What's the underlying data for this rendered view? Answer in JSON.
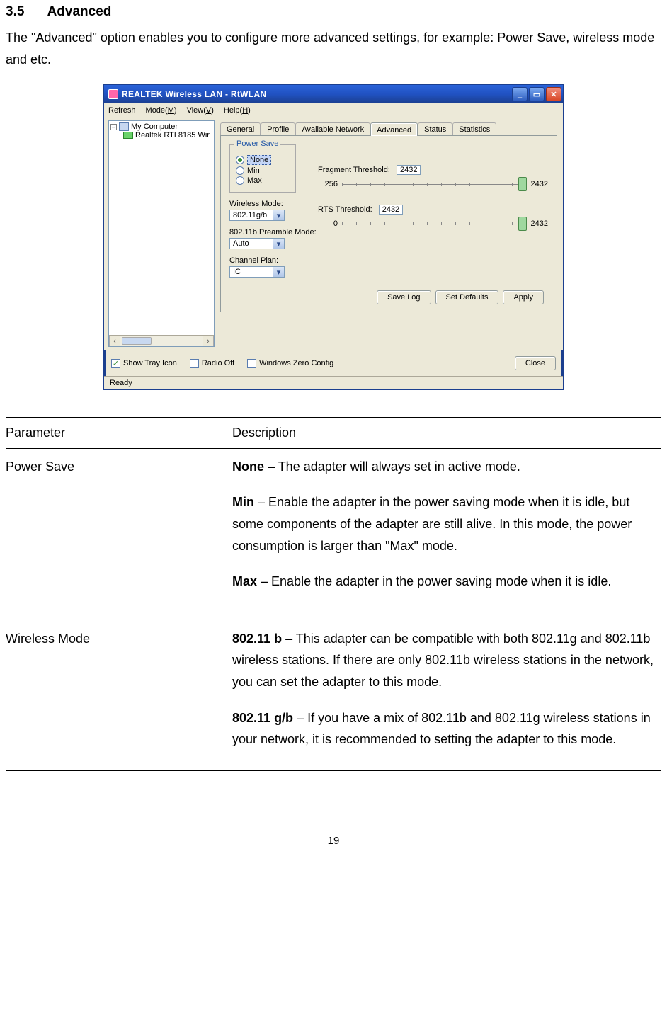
{
  "heading_num": "3.5",
  "heading_title": "Advanced",
  "intro": "The \"Advanced\" option enables you to configure more advanced settings, for example: Power Save, wireless mode and etc.",
  "window": {
    "title": "REALTEK Wireless LAN - RtWLAN",
    "menus": {
      "refresh": "Refresh",
      "mode": "Mode(M)",
      "view": "View(V)",
      "help": "Help(H)"
    },
    "tree": {
      "root": "My Computer",
      "child": "Realtek RTL8185 Wir",
      "expander": "–"
    },
    "tabs": {
      "general": "General",
      "profile": "Profile",
      "avail": "Available Network",
      "advanced": "Advanced",
      "status": "Status",
      "stats": "Statistics"
    },
    "power_save": {
      "legend": "Power Save",
      "none": "None",
      "min": "Min",
      "max": "Max"
    },
    "wireless_mode_label": "Wireless Mode:",
    "wireless_mode_value": "802.11g/b",
    "preamble_label": "802.11b Preamble Mode:",
    "preamble_value": "Auto",
    "channel_plan_label": "Channel Plan:",
    "channel_plan_value": "IC",
    "fragment": {
      "label": "Fragment Threshold:",
      "value": "2432",
      "min": "256",
      "max": "2432"
    },
    "rts": {
      "label": "RTS Threshold:",
      "value": "2432",
      "min": "0",
      "max": "2432"
    },
    "buttons": {
      "save_log": "Save Log",
      "set_defaults": "Set Defaults",
      "apply": "Apply",
      "close": "Close"
    },
    "checks": {
      "tray": "Show Tray Icon",
      "radio": "Radio Off",
      "wzc": "Windows Zero Config"
    },
    "status": "Ready"
  },
  "table": {
    "header_param": "Parameter",
    "header_desc": "Description",
    "power_save": {
      "param": "Power Save",
      "none_b": "None",
      "none_t": " – The adapter will always set in active mode.",
      "min_b": "Min",
      "min_t": " – Enable the adapter in the power saving mode when it is idle, but some components of the adapter are still alive. In this mode, the power consumption is larger than \"Max\" mode.",
      "max_b": "Max",
      "max_t": " – Enable the adapter in the power saving mode when it is idle."
    },
    "wireless_mode": {
      "param": "Wireless Mode",
      "b_b": "802.11 b",
      "b_t": " – This adapter can be compatible with both 802.11g and 802.11b wireless stations. If there are only 802.11b wireless stations in the network, you can set the adapter to this mode.",
      "gb_b": "802.11 g/b",
      "gb_t": " – If you have a mix of 802.11b and 802.11g wireless stations in your network, it is recommended to setting the adapter to this mode."
    }
  },
  "page_number": "19"
}
